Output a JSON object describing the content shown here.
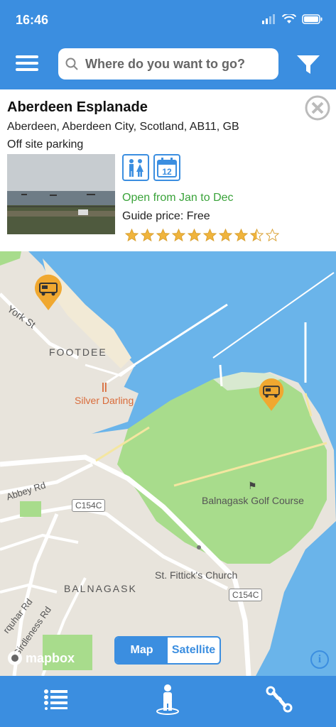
{
  "status_bar": {
    "time": "16:46"
  },
  "search": {
    "placeholder": "Where do you want to go?"
  },
  "place": {
    "title": "Aberdeen Esplanade",
    "address": "Aberdeen, Aberdeen City, Scotland, AB11, GB",
    "parking_type": "Off site parking",
    "calendar_day": "12",
    "open_text": "Open from Jan to Dec",
    "price_text": "Guide price: Free",
    "rating": 8.5,
    "rating_max": 10
  },
  "map": {
    "labels": {
      "york_st": "York St",
      "footdee": "FOOTDEE",
      "silver_darling": "Silver Darling",
      "abbey_rd": "Abbey Rd",
      "c154c": "C154C",
      "golf": "Balnagask Golf Course",
      "church": "St. Fittick's Church",
      "balnagask": "BALNAGASK",
      "farquhar": "rquhar Rd",
      "girdleness": "Girdleness Rd"
    },
    "attribution": "mapbox",
    "view_map": "Map",
    "view_satellite": "Satellite",
    "selected_view": "Map",
    "info": "i"
  },
  "colors": {
    "primary": "#3b8ee0",
    "marker": "#f0a830",
    "open": "#3aa33a",
    "water": "#6ab4ea",
    "park": "#a8dc8c"
  },
  "icons": {
    "menu": "menu-icon",
    "filter": "filter-icon",
    "close": "close-icon",
    "list": "list-icon",
    "person": "person-icon",
    "route": "route-icon"
  }
}
